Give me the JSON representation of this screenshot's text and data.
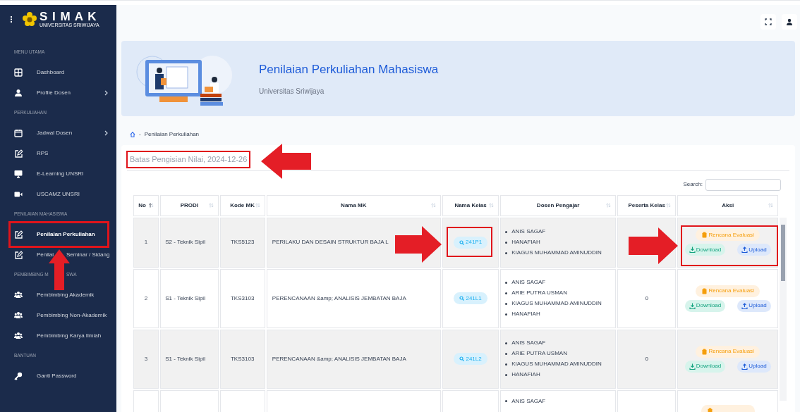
{
  "sidebar": {
    "logo": {
      "title": "S I M A K",
      "subtitle": "UNIVERSITAS SRIWIJAYA"
    },
    "sections": [
      {
        "label": "MENU UTAMA",
        "items": [
          {
            "label": "Dashboard",
            "submenu": false,
            "selected": false
          },
          {
            "label": "Profile Dosen",
            "submenu": true,
            "selected": false
          }
        ]
      },
      {
        "label": "PERKULIAHAN",
        "items": [
          {
            "label": "Jadwal Dosen",
            "submenu": true,
            "selected": false
          },
          {
            "label": "RPS",
            "submenu": false,
            "selected": false
          },
          {
            "label": "E-Learning UNSRI",
            "submenu": false,
            "selected": false
          },
          {
            "label": "USCAMZ UNSRI",
            "submenu": false,
            "selected": false
          }
        ]
      },
      {
        "label": "PENILAIAN MAHASISWA",
        "items": [
          {
            "label": "Penilaian Perkuliahan",
            "submenu": false,
            "selected": true
          },
          {
            "label": "Penilai",
            "label_after": "Seminar / Sidang",
            "submenu": false,
            "selected": false
          }
        ]
      },
      {
        "label": "PEMBIMBING M",
        "label_after": "SWA",
        "items": [
          {
            "label": "Pembimbing Akademik",
            "submenu": false,
            "selected": false
          },
          {
            "label": "Pembimbing Non-Akademik",
            "submenu": false,
            "selected": false
          },
          {
            "label": "Pembimbing Karya Ilmiah",
            "submenu": false,
            "selected": false
          }
        ]
      },
      {
        "label": "BANTUAN",
        "items": [
          {
            "label": "Ganti Password",
            "submenu": false,
            "selected": false
          }
        ]
      }
    ]
  },
  "banner": {
    "title": "Penilaian Perkuliahan Mahasiswa",
    "subtitle": "Universitas Sriwijaya"
  },
  "breadcrumb": [
    "-",
    "Penilaian Perkuliahan"
  ],
  "card": {
    "title": "Batas Pengisian Nilai, 2024-12-26",
    "search": {
      "label": "Search:"
    },
    "table": {
      "columns": [
        {
          "label": "No",
          "sorted": true
        },
        {
          "label": "PRODI",
          "sorted": false
        },
        {
          "label": "Kode MK",
          "sorted": false
        },
        {
          "label": "Nama MK",
          "sorted": false
        },
        {
          "label": "Nama Kelas",
          "sorted": false
        },
        {
          "label": "Dosen Pengajar",
          "sorted": false
        },
        {
          "label": "Peserta Kelas",
          "sorted": false
        },
        {
          "label": "Aksi",
          "sorted": false
        }
      ],
      "rows": [
        {
          "no": "1",
          "prodi": "S2 - Teknik Sipil",
          "kode": "TKS5123",
          "nama_mk": "PERILAKU DAN DESAIN STRUKTUR BAJA L",
          "kelas": "241P1",
          "dosen": [
            "ANIS SAGAF",
            "HANAFIAH",
            "KIAGUS MUHAMMAD AMINUDDIN"
          ],
          "actions": [
            {
              "kind": "plan",
              "label": "Rencana Evaluasi"
            },
            {
              "kind": "download",
              "label": "Download"
            },
            {
              "kind": "upload",
              "label": "Upload"
            }
          ]
        },
        {
          "no": "2",
          "prodi": "S1 - Teknik Sipil",
          "kode": "TKS3103",
          "nama_mk": "PERENCANAAN &amp; ANALISIS JEMBATAN BAJA",
          "kelas": "241L1",
          "dosen": [
            "ANIS SAGAF",
            "ARIE PUTRA USMAN",
            "KIAGUS MUHAMMAD AMINUDDIN",
            "HANAFIAH"
          ],
          "peserta": "0",
          "actions": [
            {
              "kind": "plan",
              "label": "Rencana Evaluasi"
            },
            {
              "kind": "download",
              "label": "Download"
            },
            {
              "kind": "upload",
              "label": "Upload"
            }
          ]
        },
        {
          "no": "3",
          "prodi": "S1 - Teknik Sipil",
          "kode": "TKS3103",
          "nama_mk": "PERENCANAAN &amp; ANALISIS JEMBATAN BAJA",
          "kelas": "241L2",
          "dosen": [
            "ANIS SAGAF",
            "ARIE PUTRA USMAN",
            "KIAGUS MUHAMMAD AMINUDDIN",
            "HANAFIAH"
          ],
          "peserta": "0",
          "actions": [
            {
              "kind": "plan",
              "label": "Rencana Evaluasi"
            },
            {
              "kind": "download",
              "label": "Download"
            },
            {
              "kind": "upload",
              "label": "Upload"
            }
          ]
        },
        {
          "dosen": [
            "ANIS SAGAF"
          ],
          "actions": [
            {
              "kind": "plan"
            }
          ]
        }
      ]
    }
  }
}
